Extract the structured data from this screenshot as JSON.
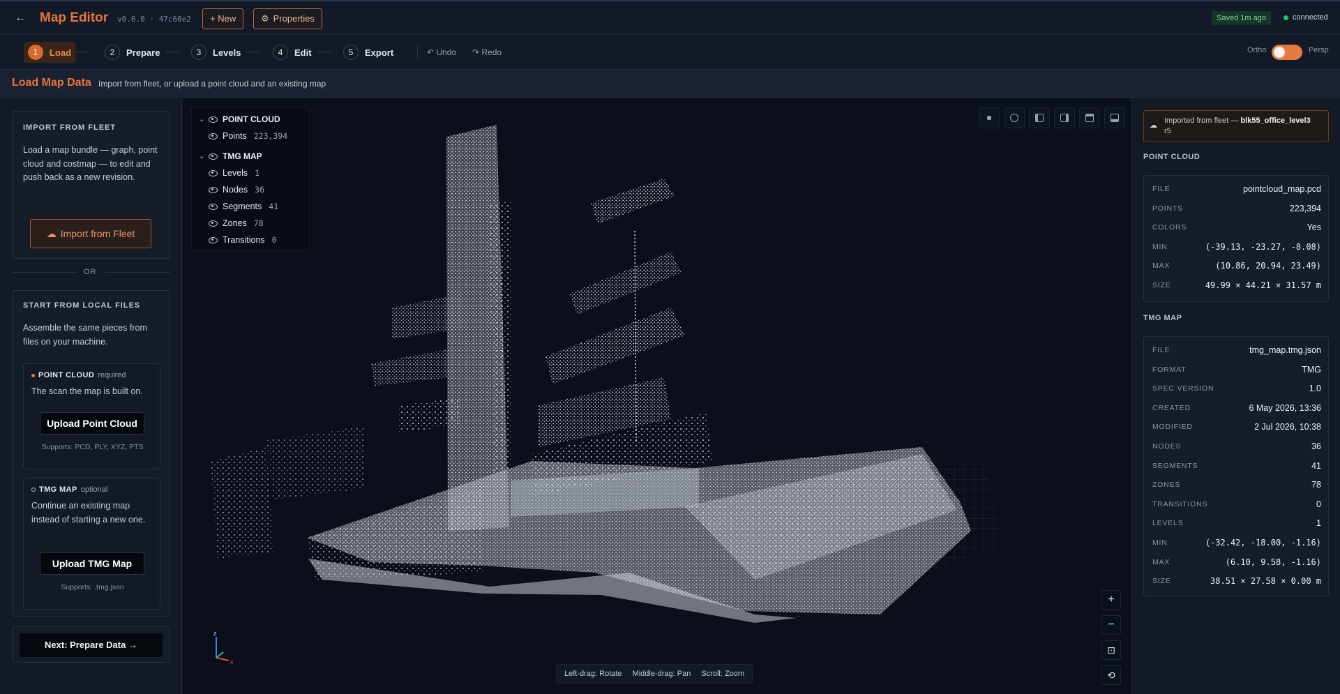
{
  "header": {
    "back_icon": "arrow-left-icon",
    "title": "Map Editor",
    "version": "v0.6.0 · 47c60e2",
    "new_label": "+ New",
    "properties_label": "Properties",
    "saved_label": "Saved 1m ago",
    "connection_label": "connected",
    "accent_color": "#e8743b",
    "connection_color": "#23c36b"
  },
  "steps": [
    {
      "num": "1",
      "label": "Load",
      "active": true
    },
    {
      "num": "2",
      "label": "Prepare"
    },
    {
      "num": "3",
      "label": "Levels"
    },
    {
      "num": "4",
      "label": "Edit"
    },
    {
      "num": "5",
      "label": "Export"
    }
  ],
  "history": {
    "undo_label": "Undo",
    "redo_label": "Redo"
  },
  "projection": {
    "left_label": "Ortho",
    "right_label": "Persp",
    "state": "Persp"
  },
  "page": {
    "title": "Load Map Data",
    "subtitle": "Import from fleet, or upload a point cloud and an existing map"
  },
  "left": {
    "import_title": "IMPORT FROM FLEET",
    "import_text": "Load a map bundle — graph, point cloud and costmap — to edit and push back as a new revision.",
    "import_button": "Import from Fleet",
    "or_label": "OR",
    "local_title": "START FROM LOCAL FILES",
    "local_text": "Assemble the same pieces from files on your machine.",
    "point_cloud": {
      "title": "POINT CLOUD",
      "tag": "required",
      "text": "The scan the map is built on.",
      "button": "Upload Point Cloud",
      "supports": "Supports: PCD, PLY, XYZ, PTS"
    },
    "tmg_map": {
      "title": "TMG MAP",
      "tag": "optional",
      "text": "Continue an existing map instead of starting a new one.",
      "button": "Upload TMG Map",
      "supports": "Supports: .tmg.json"
    },
    "next_button": "Next: Prepare Data →"
  },
  "viewport": {
    "tree": {
      "point_cloud_label": "POINT CLOUD",
      "points_label": "Points",
      "points_count": "223,394",
      "tmg_label": "TMG MAP",
      "items": [
        {
          "label": "Levels",
          "count": "1"
        },
        {
          "label": "Nodes",
          "count": "36"
        },
        {
          "label": "Segments",
          "count": "41"
        },
        {
          "label": "Zones",
          "count": "78"
        },
        {
          "label": "Transitions",
          "count": "0"
        }
      ]
    },
    "view_tools": [
      "view-points-icon",
      "view-target-icon",
      "view-left-icon",
      "view-right-icon",
      "view-top-icon",
      "view-screen-icon"
    ],
    "controls": {
      "zoom_in": "+",
      "zoom_out": "−",
      "fit": "⊡",
      "reset": "⟲"
    },
    "hints": {
      "rotate": "Left-drag: Rotate",
      "pan": "Middle-drag: Pan",
      "zoom": "Scroll: Zoom"
    },
    "axes": {
      "z": "z",
      "x": "x"
    }
  },
  "right": {
    "fleet_prefix": "Imported from fleet —",
    "fleet_name": "blk55_office_level3",
    "fleet_revision": "r5",
    "point_cloud_title": "POINT CLOUD",
    "point_cloud_props": [
      {
        "k": "FILE",
        "v": "pointcloud_map.pcd"
      },
      {
        "k": "POINTS",
        "v": "223,394"
      },
      {
        "k": "COLORS",
        "v": "Yes"
      },
      {
        "k": "MIN",
        "v": "(-39.13, -23.27, -8.08)",
        "mono": true
      },
      {
        "k": "MAX",
        "v": "(10.86, 20.94, 23.49)",
        "mono": true
      },
      {
        "k": "SIZE",
        "v": "49.99 × 44.21 × 31.57 m",
        "mono": true
      }
    ],
    "tmg_title": "TMG MAP",
    "tmg_props": [
      {
        "k": "FILE",
        "v": "tmg_map.tmg.json"
      },
      {
        "k": "FORMAT",
        "v": "TMG"
      },
      {
        "k": "SPEC VERSION",
        "v": "1.0"
      },
      {
        "k": "CREATED",
        "v": "6 May 2026, 13:36"
      },
      {
        "k": "MODIFIED",
        "v": "2 Jul 2026, 10:38"
      },
      {
        "k": "NODES",
        "v": "36"
      },
      {
        "k": "SEGMENTS",
        "v": "41"
      },
      {
        "k": "ZONES",
        "v": "78"
      },
      {
        "k": "TRANSITIONS",
        "v": "0"
      },
      {
        "k": "LEVELS",
        "v": "1"
      },
      {
        "k": "MIN",
        "v": "(-32.42, -18.00, -1.16)",
        "mono": true
      },
      {
        "k": "MAX",
        "v": "(6.10, 9.58, -1.16)",
        "mono": true
      },
      {
        "k": "SIZE",
        "v": "38.51 × 27.58 × 0.00 m",
        "mono": true
      }
    ]
  }
}
